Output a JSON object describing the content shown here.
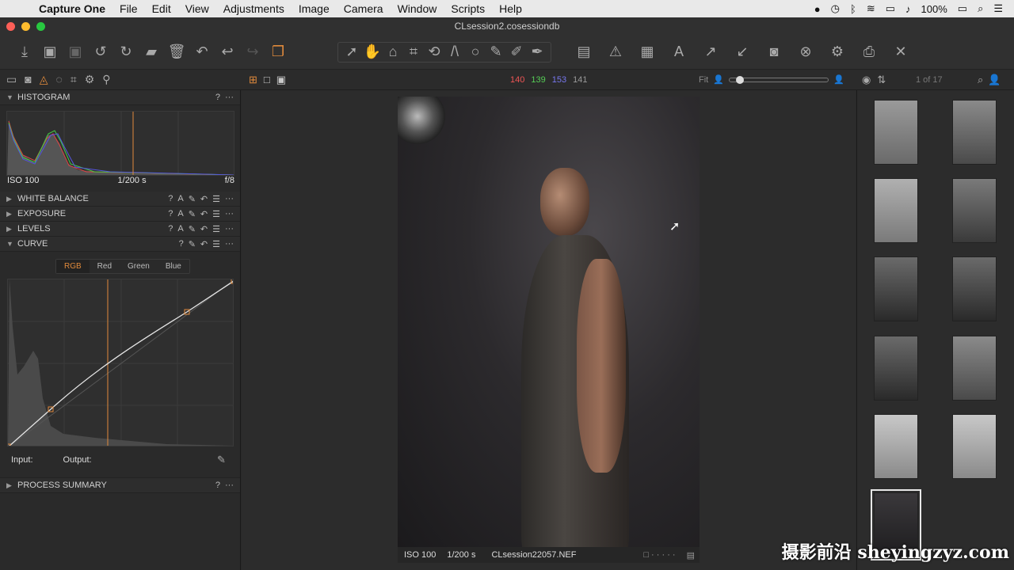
{
  "menubar": {
    "app": "Capture One",
    "items": [
      "File",
      "Edit",
      "View",
      "Adjustments",
      "Image",
      "Camera",
      "Window",
      "Scripts",
      "Help"
    ],
    "battery": "100%"
  },
  "window": {
    "title": "CLsession2.cosessiondb"
  },
  "viewer_header": {
    "rgb_r": "140",
    "rgb_g": "139",
    "rgb_b": "153",
    "rgb_l": "141",
    "fit": "Fit"
  },
  "filmstrip_header": {
    "counter": "1 of 17"
  },
  "histogram": {
    "title": "HISTOGRAM",
    "iso": "ISO 100",
    "shutter": "1/200 s",
    "aperture": "f/8"
  },
  "tools": {
    "white_balance": "WHITE BALANCE",
    "exposure": "EXPOSURE",
    "levels": "LEVELS",
    "curve": "CURVE",
    "process_summary": "PROCESS SUMMARY"
  },
  "curve": {
    "tabs": [
      "RGB",
      "Red",
      "Green",
      "Blue"
    ],
    "active_tab": "RGB",
    "input_label": "Input:",
    "output_label": "Output:"
  },
  "viewer_footer": {
    "iso": "ISO 100",
    "shutter": "1/200 s",
    "filename": "CLsession22057.NEF"
  },
  "watermark": "摄影前沿 sheyingzyz.com",
  "colors": {
    "accent": "#e08a3c",
    "red": "#d9534f",
    "green": "#5cb85c",
    "blue": "#6a6ad8"
  }
}
